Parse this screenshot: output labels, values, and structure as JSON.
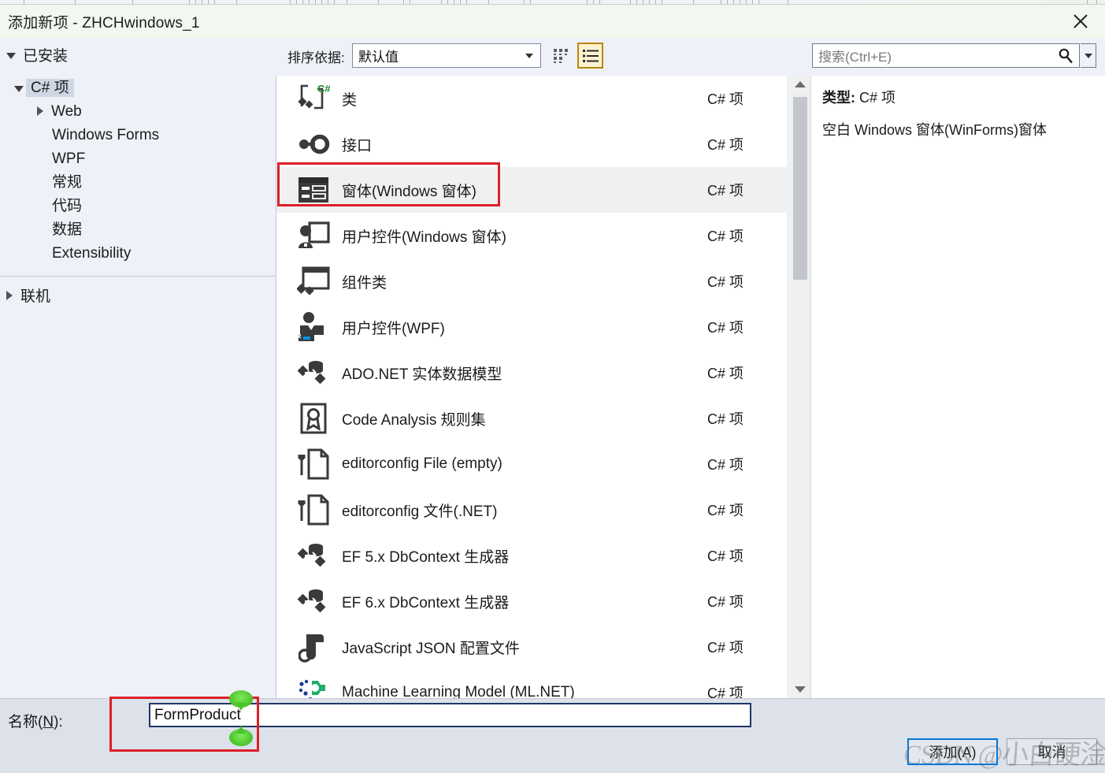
{
  "window": {
    "title": "添加新项 - ZHCHwindows_1",
    "close_icon": "close-icon"
  },
  "toolbar": {
    "installed_label": "已安装",
    "sort_label": "排序依据:",
    "sort_value": "默认值",
    "grid_view_icon": "grid-view-icon",
    "list_view_icon": "list-view-icon",
    "search_placeholder": "搜索(Ctrl+E)",
    "search_value": "",
    "search_icon": "search-icon"
  },
  "tree": {
    "root_label": "C# 项",
    "items": [
      {
        "label": "Web",
        "expandable": true,
        "indent": 48
      },
      {
        "label": "Windows Forms",
        "expandable": false,
        "indent": 66
      },
      {
        "label": "WPF",
        "expandable": false,
        "indent": 66
      },
      {
        "label": "常规",
        "expandable": false,
        "indent": 66
      },
      {
        "label": "代码",
        "expandable": false,
        "indent": 66
      },
      {
        "label": "数据",
        "expandable": false,
        "indent": 66
      },
      {
        "label": "Extensibility",
        "expandable": false,
        "indent": 66
      }
    ],
    "online_label": "联机"
  },
  "list": {
    "kind_column": "C# 项",
    "items": [
      {
        "name": "类",
        "kind": "C# 项",
        "icon": "class-icon",
        "selected": false
      },
      {
        "name": "接口",
        "kind": "C# 项",
        "icon": "interface-icon",
        "selected": false
      },
      {
        "name": "窗体(Windows 窗体)",
        "kind": "C# 项",
        "icon": "windows-form-icon",
        "selected": true
      },
      {
        "name": "用户控件(Windows 窗体)",
        "kind": "C# 项",
        "icon": "user-control-winforms-icon",
        "selected": false
      },
      {
        "name": "组件类",
        "kind": "C# 项",
        "icon": "component-class-icon",
        "selected": false
      },
      {
        "name": "用户控件(WPF)",
        "kind": "C# 项",
        "icon": "user-control-wpf-icon",
        "selected": false
      },
      {
        "name": "ADO.NET 实体数据模型",
        "kind": "C# 项",
        "icon": "ado-net-entity-icon",
        "selected": false
      },
      {
        "name": "Code Analysis 规则集",
        "kind": "C# 项",
        "icon": "code-analysis-icon",
        "selected": false
      },
      {
        "name": "editorconfig File (empty)",
        "kind": "C# 项",
        "icon": "editorconfig-icon",
        "selected": false
      },
      {
        "name": "editorconfig 文件(.NET)",
        "kind": "C# 项",
        "icon": "editorconfig-icon",
        "selected": false
      },
      {
        "name": "EF 5.x DbContext 生成器",
        "kind": "C# 项",
        "icon": "ef-dbcontext-icon",
        "selected": false
      },
      {
        "name": "EF 6.x DbContext 生成器",
        "kind": "C# 项",
        "icon": "ef-dbcontext-icon",
        "selected": false
      },
      {
        "name": "JavaScript JSON 配置文件",
        "kind": "C# 项",
        "icon": "json-config-icon",
        "selected": false
      },
      {
        "name": "Machine Learning Model (ML.NET)",
        "kind": "C# 项",
        "icon": "ml-model-icon",
        "selected": false
      }
    ]
  },
  "details": {
    "type_label": "类型:",
    "type_value": "C# 项",
    "description": "空白 Windows 窗体(WinForms)窗体"
  },
  "bottom": {
    "name_label_prefix": "名称(",
    "name_label_key": "N",
    "name_label_suffix": "):",
    "name_value": "FormProduct",
    "add_button": "添加(A)",
    "cancel_button": "取消"
  },
  "annotations": {
    "watermark": "CSDN @小白硬淦零号",
    "box_color": "#dd2028",
    "pin_color": "#4cc22a"
  },
  "colors": {
    "titlebar": "#f2f7ef",
    "panel": "#eef1f7",
    "list_bg": "#ffffff",
    "row_selected": "#f0f0f0",
    "bottom_bar": "#dde1ea",
    "focus_blue": "#0078d7",
    "input_border": "#1f3864",
    "active_view_border": "#b8860b"
  }
}
